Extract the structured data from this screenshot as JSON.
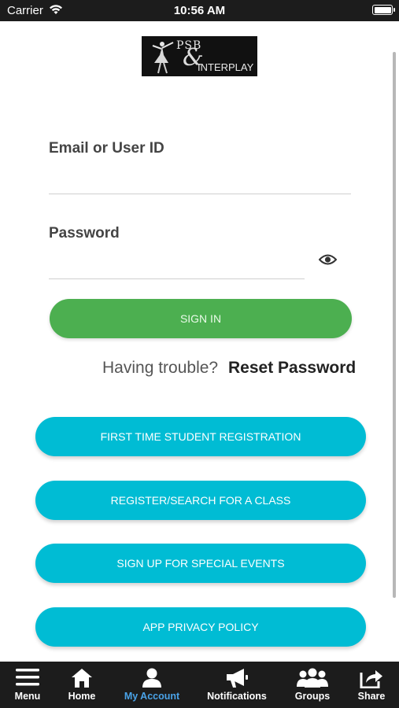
{
  "status_bar": {
    "carrier": "Carrier",
    "time": "10:56 AM"
  },
  "logo": {
    "line1": "PSB",
    "amp": "&",
    "line2": "INTERPLAY"
  },
  "form": {
    "email_label": "Email or User ID",
    "email_value": "",
    "password_label": "Password",
    "password_value": "",
    "sign_in_label": "SIGN IN",
    "trouble_text": "Having trouble?",
    "reset_label": "Reset Password"
  },
  "buttons": [
    {
      "label": "FIRST TIME STUDENT REGISTRATION"
    },
    {
      "label": "REGISTER/SEARCH FOR A CLASS"
    },
    {
      "label": "SIGN UP FOR SPECIAL EVENTS"
    },
    {
      "label": "APP PRIVACY POLICY"
    }
  ],
  "tab_bar": {
    "items": [
      {
        "label": "Menu",
        "icon": "menu-icon"
      },
      {
        "label": "Home",
        "icon": "home-icon"
      },
      {
        "label": "My Account",
        "icon": "user-icon",
        "active": true
      },
      {
        "label": "Notifications",
        "icon": "megaphone-icon"
      },
      {
        "label": "Groups",
        "icon": "group-icon"
      },
      {
        "label": "Share",
        "icon": "share-icon"
      }
    ]
  },
  "colors": {
    "sign_in": "#4caf50",
    "action_buttons": "#00bcd4",
    "active_tab": "#4aa3e8",
    "bars": "#1c1c1c"
  }
}
